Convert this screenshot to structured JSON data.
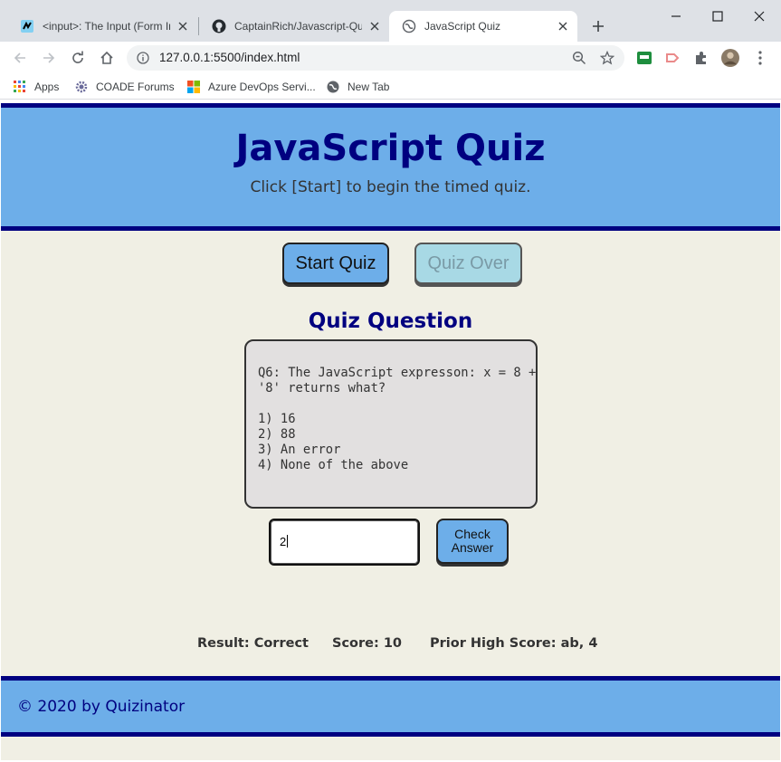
{
  "browser": {
    "tabs": [
      {
        "title": "<input>: The Input (Form In",
        "active": false,
        "icon": "mdn-icon"
      },
      {
        "title": "CaptainRich/Javascript-Quiz",
        "active": false,
        "icon": "github-icon"
      },
      {
        "title": "JavaScript Quiz",
        "active": true,
        "icon": "globe-icon"
      }
    ],
    "url": "127.0.0.1:5500/index.html",
    "bookmarks": [
      {
        "label": "Apps",
        "icon": "apps-grid-icon"
      },
      {
        "label": "COADE Forums",
        "icon": "gear-icon"
      },
      {
        "label": "Azure DevOps Servi...",
        "icon": "microsoft-icon"
      },
      {
        "label": "New Tab",
        "icon": "globe-icon"
      }
    ]
  },
  "page": {
    "title": "JavaScript Quiz",
    "subtitle": "Click [Start] to begin the timed quiz.",
    "start_button": "Start Quiz",
    "over_button": "Quiz Over",
    "question_title": "Quiz Question",
    "question_lines": [
      "Q6: The JavaScript expresson: x = 8 +",
      "'8' returns what?",
      "",
      "1) 16",
      "2) 88",
      "3) An error",
      "4) None of the above"
    ],
    "answer_value": "2",
    "check_button_line1": "Check",
    "check_button_line2": "Answer",
    "result": "Result: Correct",
    "score": "Score: 10",
    "high_score": "Prior High Score: ab, 4",
    "footer": "© 2020 by Quizinator"
  },
  "colors": {
    "header_bg": "#6daee9",
    "navy": "#000080",
    "page_bg": "#f0efe4",
    "question_bg": "#e2e0e0",
    "disabled_button": "#a8d9e5"
  }
}
